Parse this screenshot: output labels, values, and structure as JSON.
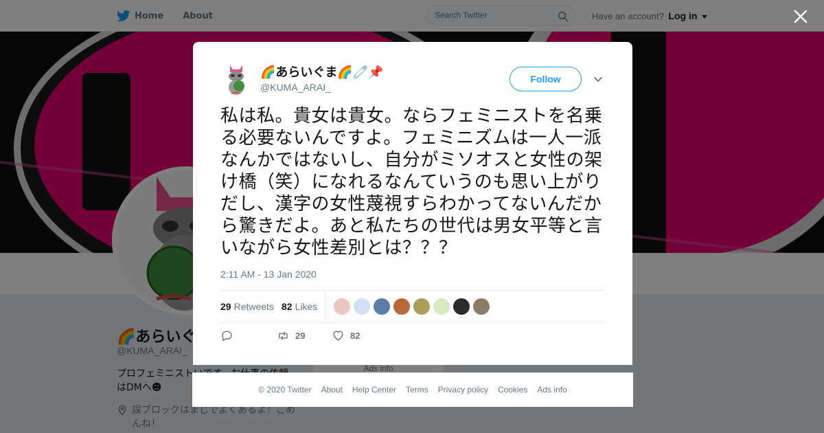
{
  "header": {
    "home_label": "Home",
    "about_label": "About",
    "search_placeholder": "Search Twitter",
    "account_prompt": "Have an account?",
    "login_label": "Log in"
  },
  "profile": {
    "display_name": "🌈あらいぐま",
    "handle": "@KUMA_ARAI_",
    "bio": "プロフェミニストいです。お仕事の依頼はDMへ☻",
    "location": "誤ブロックはまじでよくあるよ！ごめんね！",
    "ads_info": "Ads info"
  },
  "tweet": {
    "author_name": "🌈あらいぐま🌈🧷📌",
    "author_handle": "@KUMA_ARAI_",
    "follow_label": "Follow",
    "text": "私は私。貴女は貴女。ならフェミニストを名乗る必要ないんですよ。フェミニズムは一人一派なんかではないし、自分がミソオスと女性の架け橋（笑）になれるなんていうのも思い上がりだし、漢字の女性蔑視すらわかってないんだから驚きだよ。あと私たちの世代は男女平等と言いながら女性差別とは？？？",
    "timestamp": "2:11 AM - 13 Jan 2020",
    "retweets_count": "29",
    "retweets_label": "Retweets",
    "likes_count": "82",
    "likes_label": "Likes",
    "retweet_action_count": "29",
    "like_action_count": "82",
    "liker_avatar_colors": [
      "#e9c7c0",
      "#cfe0f5",
      "#5b7fa6",
      "#b8683a",
      "#a8a05a",
      "#d8e8c0",
      "#2c2c2c",
      "#8a7d66"
    ]
  },
  "footer": {
    "copyright": "© 2020 Twitter",
    "links": [
      "About",
      "Help Center",
      "Terms",
      "Privacy policy",
      "Cookies",
      "Ads info"
    ]
  },
  "colors": {
    "accent": "#1da1f2",
    "banner_pink": "#e6006f",
    "text_primary": "#14171a",
    "text_secondary": "#657786"
  },
  "icons": {
    "logo": "twitter-bird-icon",
    "search": "search-icon",
    "close": "close-icon",
    "more": "chevron-down-icon",
    "reply": "reply-icon",
    "retweet": "retweet-icon",
    "like": "heart-icon",
    "location": "location-pin-icon"
  }
}
